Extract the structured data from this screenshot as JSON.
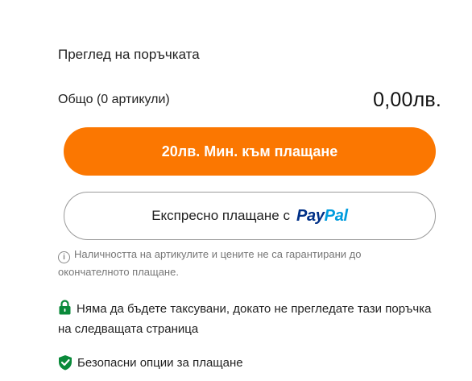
{
  "summary": {
    "title": "Преглед на поръчката",
    "total_label": "Общо (0 артикули)",
    "total_amount": "0,00лв."
  },
  "buttons": {
    "checkout_label": "20лв. Мин. към плащане",
    "paypal_label": "Експресно плащане с",
    "paypal_logo_pay": "Pay",
    "paypal_logo_pal": "Pal"
  },
  "notices": {
    "availability_note": "Наличността на артикулите и цените не са гарантирани до окончателното плащане.",
    "no_charge_note": "Няма да бъдете таксувани, докато не прегледате тази поръчка на следващата страница",
    "secure_payment": "Безопасни опции за плащане"
  },
  "colors": {
    "accent": "#fb7701",
    "paypal_dark": "#003087",
    "paypal_light": "#009cde",
    "secure_green": "#0a8a3a"
  },
  "icons": {
    "info": "info-circle-icon",
    "lock": "lock-icon",
    "shield": "shield-check-icon"
  }
}
